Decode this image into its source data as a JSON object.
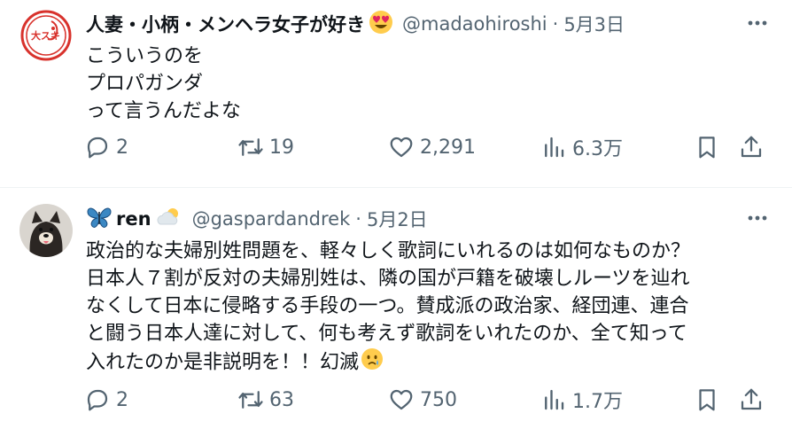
{
  "tweets": [
    {
      "display_name": "人妻・小柄・メンヘラ女子が好き",
      "handle": "@madaohiroshi",
      "dot": "·",
      "date": "5月3日",
      "text_lines": [
        "こういうのを",
        "プロパガンダ",
        "って言うんだよな"
      ],
      "avatar_text": "大スキ",
      "replies": "2",
      "reposts": "19",
      "likes": "2,291",
      "views": "6.3万"
    },
    {
      "display_name": "ren",
      "handle": "@gaspardandrek",
      "dot": "·",
      "date": "5月2日",
      "text_lines": [
        "政治的な夫婦別姓問題を、軽々しく歌詞にいれるのは如何なものか？",
        "日本人７割が反対の夫婦別姓は、隣の国が戸籍を破壊しルーツを辿れ",
        "なくして日本に侵略する手段の一つ。賛成派の政治家、経団連、連合",
        "と闘う日本人達に対して、何も考えず歌詞をいれたのか、全て知って",
        "入れたのか是非説明を！！幻滅"
      ],
      "replies": "2",
      "reposts": "63",
      "likes": "750",
      "views": "1.7万"
    }
  ],
  "icons": {
    "reply": "reply-icon",
    "repost": "repost-icon",
    "like": "heart-icon",
    "views": "views-icon",
    "bookmark": "bookmark-icon",
    "share": "share-icon",
    "more": "more-icon"
  },
  "colors": {
    "text": "#0f1419",
    "secondary": "#536471",
    "divider": "#eff3f4"
  }
}
